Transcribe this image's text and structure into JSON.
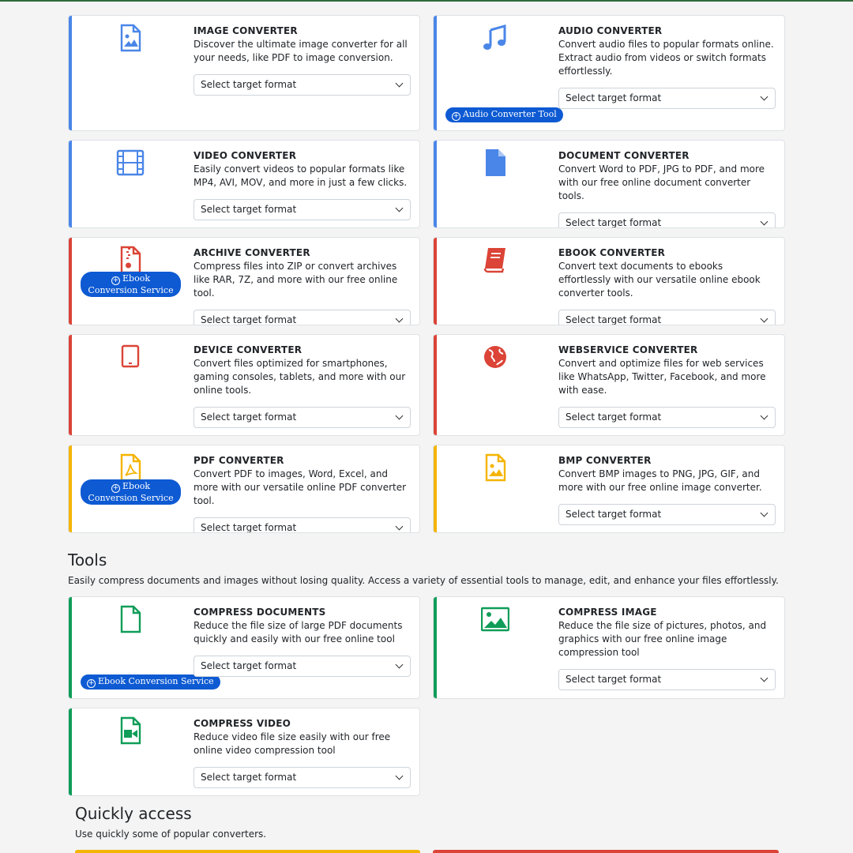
{
  "select_placeholder": "Select target format",
  "cards": [
    {
      "title": "IMAGE CONVERTER",
      "desc": "Discover the ultimate image converter for all your needs, like PDF to image conversion.",
      "icon": "image-file-icon",
      "accent": "#4a86e8"
    },
    {
      "title": "AUDIO CONVERTER",
      "desc": "Convert audio files to popular formats online. Extract audio from videos or switch formats effortlessly.",
      "icon": "music-note-icon",
      "accent": "#4a86e8",
      "badge": "Audio Converter Tool"
    },
    {
      "title": "VIDEO CONVERTER",
      "desc": "Easily convert videos to popular formats like MP4, AVI, MOV, and more in just a few clicks.",
      "icon": "film-icon",
      "accent": "#4a86e8"
    },
    {
      "title": "DOCUMENT CONVERTER",
      "desc": "Convert Word to PDF, JPG to PDF, and more with our free online document converter tools.",
      "icon": "document-icon",
      "accent": "#4a86e8"
    },
    {
      "title": "ARCHIVE CONVERTER",
      "desc": "Compress files into ZIP or convert archives like RAR, 7Z, and more with our free online tool.",
      "icon": "zip-file-icon",
      "accent": "#db4437",
      "badge": "Ebook Conversion Service"
    },
    {
      "title": "EBOOK CONVERTER",
      "desc": "Convert text documents to ebooks effortlessly with our versatile online ebook converter tools.",
      "icon": "book-icon",
      "accent": "#db4437"
    },
    {
      "title": "DEVICE CONVERTER",
      "desc": "Convert files optimized for smartphones, gaming consoles, tablets, and more with our online tools.",
      "icon": "tablet-icon",
      "accent": "#db4437"
    },
    {
      "title": "WEBSERVICE CONVERTER",
      "desc": "Convert and optimize files for web services like WhatsApp, Twitter, Facebook, and more with ease.",
      "icon": "globe-icon",
      "accent": "#db4437"
    },
    {
      "title": "PDF CONVERTER",
      "desc": "Convert PDF to images, Word, Excel, and more with our versatile online PDF converter tool.",
      "icon": "pdf-file-icon",
      "accent": "#f4b400",
      "badge": "Ebook Conversion Service"
    },
    {
      "title": "BMP CONVERTER",
      "desc": "Convert BMP images to PNG, JPG, GIF, and more with our free online image converter.",
      "icon": "image-file-icon",
      "accent": "#f4b400"
    },
    {
      "title": "COMPRESS DOCUMENTS",
      "desc": "Reduce the file size of large PDF documents quickly and easily with our free online tool",
      "icon": "blank-file-icon",
      "accent": "#0f9d58",
      "badge": "Ebook Conversion Service"
    },
    {
      "title": "COMPRESS IMAGE",
      "desc": "Reduce the file size of pictures, photos, and graphics with our free online image compression tool",
      "icon": "picture-icon",
      "accent": "#0f9d58"
    },
    {
      "title": "COMPRESS VIDEO",
      "desc": "Reduce video file size easily with our free online video compression tool",
      "icon": "video-file-icon",
      "accent": "#0f9d58"
    }
  ],
  "tools": {
    "heading": "Tools",
    "subtitle": "Easily compress documents and images without losing quality. Access a variety of essential tools to manage, edit, and enhance your files effortlessly."
  },
  "quick_access": {
    "heading": "Quickly access",
    "subtitle": "Use quickly some of popular converters.",
    "bar_colors": [
      "#f4b400",
      "#db4437"
    ]
  }
}
